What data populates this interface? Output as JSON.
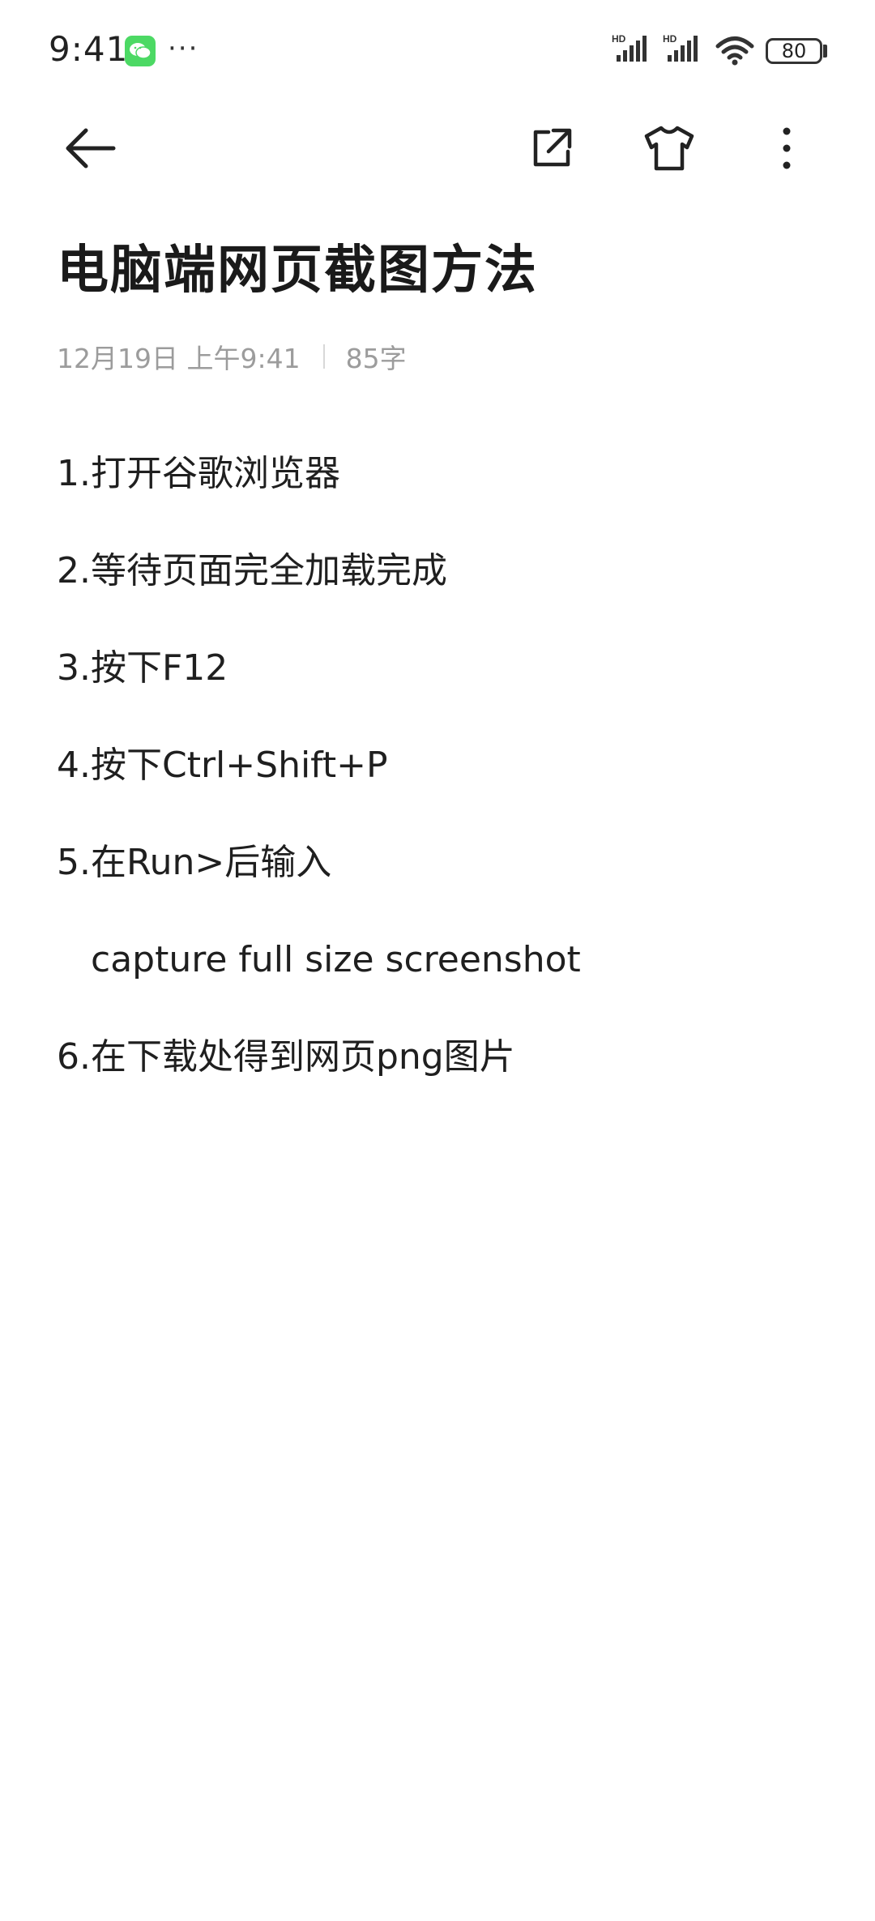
{
  "status_bar": {
    "time": "9:41",
    "more_indicator": "···",
    "battery": "80",
    "signal_label": "HD"
  },
  "toolbar": {
    "back_icon": "arrow-left-icon",
    "share_icon": "share-external-icon",
    "theme_icon": "tshirt-icon",
    "more_icon": "more-vertical-icon"
  },
  "note": {
    "title": "电脑端网页截图方法",
    "date": "12月19日 上午9:41",
    "word_count": "85字",
    "lines": [
      "1.打开谷歌浏览器",
      "2.等待页面完全加载完成",
      "3.按下F12",
      "4.按下Ctrl+Shift+P",
      "5.在Run>后输入",
      "capture full size screenshot",
      "6.在下载处得到网页png图片"
    ]
  },
  "colors": {
    "background": "#ffffff",
    "text": "#1f1f1f",
    "meta": "#9c9c9c",
    "wechat": "#4cd964"
  }
}
